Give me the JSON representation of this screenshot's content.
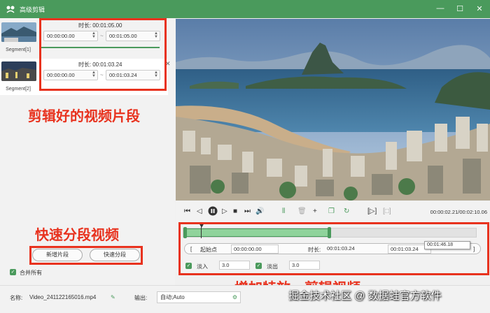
{
  "window": {
    "title": "高级剪辑"
  },
  "segments": [
    {
      "label": "Segment[1]",
      "duration_label": "时长:",
      "duration": "00:01:05.00",
      "start": "00:00:00.00",
      "end": "00:01:05.00"
    },
    {
      "label": "Segment[2]",
      "duration_label": "时长:",
      "duration": "00:01:03.24",
      "start": "00:00:00.00",
      "end": "00:01:03.24"
    }
  ],
  "tilde": "~",
  "left_actions": {
    "add_segment": "新增片段",
    "quick_split": "快速分段",
    "merge_all": "合并所有"
  },
  "annotations": {
    "clips": "剪辑好的视频片段",
    "quick_split": "快速分段视频",
    "effects": "增加特效、剪辑视频"
  },
  "player": {
    "current_time": "00:00:02.21",
    "total_time": "00:02:10.06"
  },
  "trim": {
    "start_label": "起始点",
    "start_value": "00:00:00.00",
    "duration_label": "时长:",
    "duration_value": "00:01:03.24",
    "end_value": "00:01:03.24",
    "tooltip": "00:01:46.18",
    "fill_fraction": 0.5
  },
  "fade": {
    "in_label": "淡入",
    "in_value": "3.0",
    "out_label": "淡出",
    "out_value": "3.0"
  },
  "bottom": {
    "name_label": "名称:",
    "file_name": "Video_241122165016.mp4",
    "output_label": "输出:",
    "output_value": "自动;Auto"
  },
  "watermark": "掘金技术社区 @ 数据蛙官方软件",
  "colors": {
    "accent": "#4a9a5c",
    "annotation": "#e8321e"
  }
}
